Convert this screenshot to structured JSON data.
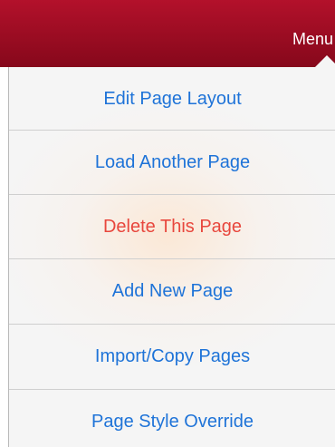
{
  "navbar": {
    "menu_label": "Menu",
    "color": "#9a0c22"
  },
  "menu": {
    "items": [
      {
        "label": "Edit Page Layout",
        "color": "#1e73d8"
      },
      {
        "label": "Load Another Page",
        "color": "#1e73d8"
      },
      {
        "label": "Delete This Page",
        "color": "#e8473d"
      },
      {
        "label": "Add New Page",
        "color": "#1e73d8"
      },
      {
        "label": "Import/Copy Pages",
        "color": "#1e73d8"
      },
      {
        "label": "Page Style Override",
        "color": "#1e73d8"
      }
    ]
  }
}
